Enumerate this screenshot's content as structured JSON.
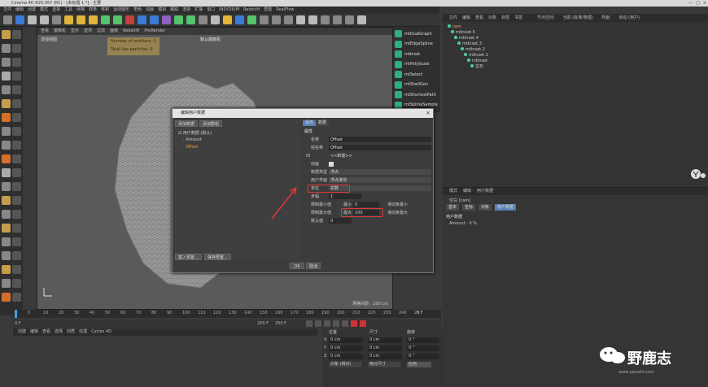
{
  "app": {
    "title": "Cinema 4D R20.057 (RC) - [未标题 1 *] - 主要",
    "controls": [
      "—",
      "□",
      "×"
    ]
  },
  "menu": [
    "文件",
    "编辑",
    "创建",
    "模式",
    "选择",
    "工具",
    "网格",
    "样条",
    "体积",
    "运动图形",
    "角色",
    "动画",
    "模拟",
    "跟踪",
    "渲染",
    "扩展",
    "窗口",
    "INSYDIUM",
    "Redshift",
    "帮助",
    "RealFlow"
  ],
  "viewport": {
    "menu": [
      "查看",
      "摄像机",
      "显示",
      "选项",
      "过滤",
      "面板",
      "Redshift",
      "ProRender"
    ],
    "label": "透视视图",
    "camera": "默认摄像机",
    "hud": [
      "Number of emitters: 0",
      "Total live particles: 0"
    ],
    "grid": "网格间距 : 100 cm"
  },
  "plugins": [
    "mtDualGraph",
    "mtEdgeSpline",
    "mtInset",
    "mtPolyScale",
    "mtSelect",
    "mtShellGen",
    "mtShortestPath",
    "mtSplineSample"
  ],
  "objects": {
    "menu": [
      "文件",
      "编辑",
      "查看",
      "对象",
      "标签",
      "书签"
    ],
    "right_header": [
      "节点空间:",
      "当前 (标准/物理)",
      "界面:",
      "启动 (用户)"
    ],
    "items": [
      {
        "name": "cam",
        "indent": 0
      },
      {
        "name": "mtInset.5",
        "indent": 1
      },
      {
        "name": "mtInset.4",
        "indent": 2
      },
      {
        "name": "mtInset.3",
        "indent": 3
      },
      {
        "name": "mtInset.2",
        "indent": 4
      },
      {
        "name": "mtInset.1",
        "indent": 5
      },
      {
        "name": "mtInset",
        "indent": 6
      },
      {
        "name": "宝石",
        "indent": 7
      }
    ]
  },
  "attributes": {
    "menu": [
      "模式",
      "编辑",
      "用户数据"
    ],
    "object": "空白 [cam]",
    "tabs": [
      "基本",
      "坐标",
      "对象",
      "用户数据"
    ],
    "section": "用户数据",
    "field_label": "Amount",
    "field_value": "0 %"
  },
  "timeline": {
    "ticks": [
      "0",
      "10",
      "20",
      "30",
      "40",
      "50",
      "60",
      "70",
      "80",
      "90",
      "100",
      "110",
      "120",
      "130",
      "140",
      "150",
      "160",
      "170",
      "180",
      "190",
      "200",
      "210",
      "220",
      "230",
      "240",
      "25"
    ],
    "end": "0 F",
    "start_frame": "0 F",
    "frame_a": "250 F",
    "frame_b": "250 F"
  },
  "materials": {
    "menu": [
      "创建",
      "编辑",
      "查看",
      "选择",
      "材质",
      "纹理",
      "Cycles 4D"
    ]
  },
  "coords": {
    "headers": [
      "位置",
      "尺寸",
      "旋转"
    ],
    "x": "0 cm",
    "y": "0 cm",
    "z": "0 cm",
    "sx": "0 cm",
    "sy": "0 cm",
    "sz": "0 cm",
    "h": "0 °",
    "p": "0 °",
    "b": "0 °",
    "mode": "对象 (相对)",
    "size_mode": "绝对尺寸",
    "apply": "应用"
  },
  "dialog": {
    "title": "编辑用户数据",
    "btn_add": "添加数据",
    "btn_group": "添加群组",
    "tree_root": "用户数据 (默认)",
    "tree_items": [
      "Amount",
      "Offset"
    ],
    "btn_load": "载入预置...",
    "btn_save": "保存预置...",
    "tabs": [
      "属性",
      "数据"
    ],
    "section": "属性",
    "name_label": "名称",
    "name_value": "Offset",
    "short_label": "短名称",
    "short_value": "Offset",
    "id_label": "ID",
    "id_value": "<<新建>>",
    "anim_label": "动画",
    "type_label": "数据类型",
    "type_value": "浮点",
    "ui_label": "用户界面",
    "ui_value": "浮点滑块",
    "unit_label": "单位",
    "unit_value": "实数",
    "step_label": "步幅",
    "step_value": "1",
    "min_label": "限制最小值",
    "min_field": "最小",
    "min_value": "0",
    "max_label": "限制最大值",
    "max_field": "最大",
    "max_value": "100",
    "smin": "滑动条最小",
    "smax": "滑动条最大",
    "default_label": "默认值",
    "default_value": "0",
    "ok": "OK",
    "cancel": "取消"
  },
  "watermark": {
    "text": "野鹿志",
    "url": "www.yeluzhi.com"
  }
}
